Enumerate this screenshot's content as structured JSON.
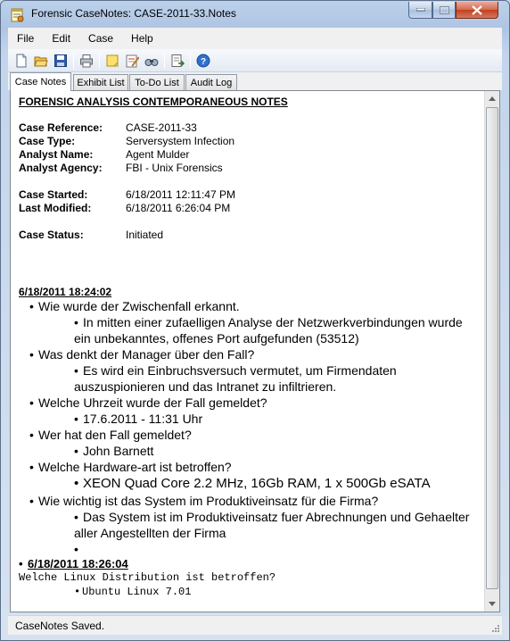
{
  "window": {
    "title": "Forensic CaseNotes: CASE-2011-33.Notes"
  },
  "menu": [
    "File",
    "Edit",
    "Case",
    "Help"
  ],
  "toolbar": {
    "icons": [
      "new-icon",
      "open-icon",
      "save-icon",
      "print-icon",
      "note-icon",
      "edit-note-icon",
      "find-icon",
      "export-icon",
      "help-icon"
    ]
  },
  "tabs": [
    "Case Notes",
    "Exhibit List",
    "To-Do List",
    "Audit Log"
  ],
  "doc": {
    "heading": "FORENSIC ANALYSIS CONTEMPORANEOUS NOTES",
    "fields": [
      {
        "label": "Case Reference:",
        "value": "CASE-2011-33"
      },
      {
        "label": "Case Type:",
        "value": "Serversystem Infection"
      },
      {
        "label": "Analyst Name:",
        "value": "Agent Mulder"
      },
      {
        "label": "Analyst Agency:",
        "value": "FBI - Unix Forensics"
      }
    ],
    "dates": [
      {
        "label": "Case Started:",
        "value": "6/18/2011 12:11:47 PM"
      },
      {
        "label": "Last Modified:",
        "value": "6/18/2011 6:26:04 PM"
      }
    ],
    "status": {
      "label": "Case Status:",
      "value": "Initiated"
    },
    "entry1": {
      "date": "6/18/2011 18:24:02",
      "q1": "Wie wurde der Zwischenfall erkannt.",
      "a1": "In mitten einer zufaelligen Analyse der Netzwerkverbindungen wurde ein unbekanntes, offenes Port aufgefunden (53512)",
      "q2": "Was denkt der Manager über den Fall?",
      "a2": "Es wird ein Einbruchsversuch vermutet, um Firmendaten auszuspionieren und das Intranet zu infiltrieren.",
      "q3": "Welche Uhrzeit wurde der Fall gemeldet?",
      "a3": "17.6.2011 - 11:31 Uhr",
      "q4": "Wer hat den Fall gemeldet?",
      "a4": "John Barnett",
      "q5": "Welche Hardware-art ist betroffen?",
      "a5": "XEON Quad Core 2.2 MHz, 16Gb RAM, 1 x 500Gb eSATA",
      "q6": "Wie wichtig ist das System im Produktiveinsatz für die Firma?",
      "a6": "Das System ist im Produktiveinsatz fuer Abrechnungen und Gehaelter aller Angestellten der Firma"
    },
    "entry2": {
      "date": "6/18/2011 18:26:04",
      "q1": "Welche Linux Distribution ist betroffen?",
      "a1": "Ubuntu Linux 7.01"
    }
  },
  "status_bar": "CaseNotes Saved."
}
